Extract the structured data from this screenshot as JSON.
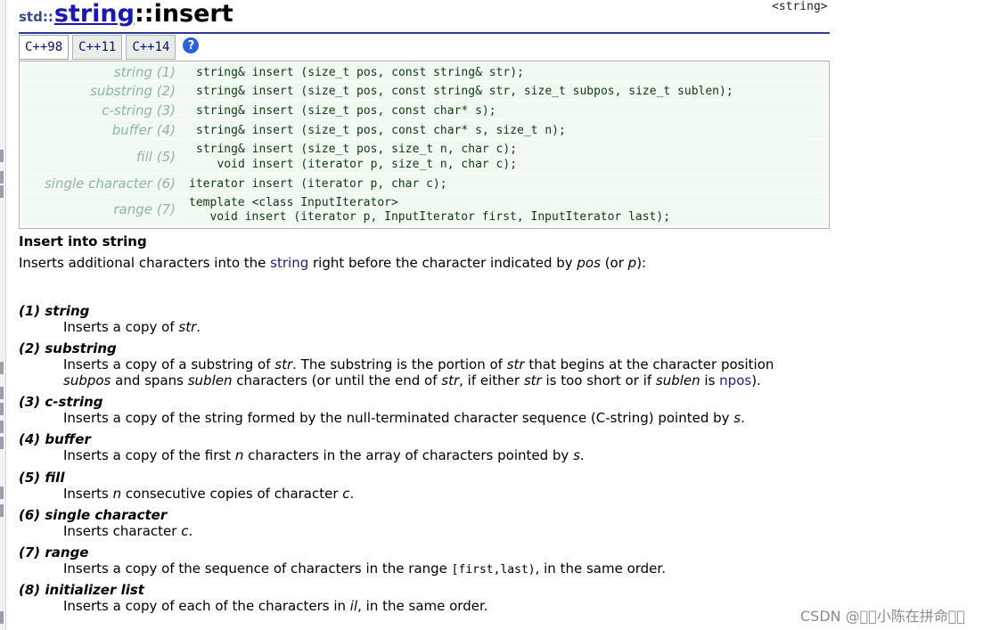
{
  "title": {
    "namespace": "std::",
    "class_name": "string",
    "separator": "::",
    "function": "insert"
  },
  "header_tag": "<string>",
  "tabs": [
    {
      "label": "C++98"
    },
    {
      "label": "C++11"
    },
    {
      "label": "C++14"
    }
  ],
  "help_icon_label": "?",
  "prototypes": [
    {
      "label": "string (1)",
      "lines": [
        "string& insert (size_t pos, const string& str);"
      ]
    },
    {
      "label": "substring (2)",
      "lines": [
        "string& insert (size_t pos, const string& str, size_t subpos, size_t sublen);"
      ]
    },
    {
      "label": "c-string (3)",
      "lines": [
        "string& insert (size_t pos, const char* s);"
      ]
    },
    {
      "label": "buffer (4)",
      "lines": [
        "string& insert (size_t pos, const char* s, size_t n);"
      ]
    },
    {
      "label": "fill (5)",
      "lines": [
        "string& insert (size_t pos, size_t n, char c);",
        "   void insert (iterator p, size_t n, char c);"
      ]
    },
    {
      "label": "single character (6)",
      "lines": [
        "iterator insert (iterator p, char c);"
      ]
    },
    {
      "label": "range (7)",
      "lines": [
        "template <class InputIterator>",
        "   void insert (iterator p, InputIterator first, InputIterator last);"
      ]
    }
  ],
  "heading": "Insert into string",
  "intro": {
    "before": "Inserts additional characters into the ",
    "link": "string",
    "middle": " right before the character indicated by ",
    "pos": "pos",
    "or": " (or ",
    "p": "p",
    "end": "):"
  },
  "sections": [
    {
      "head": "(1) string",
      "desc": [
        [
          {
            "t": "Inserts a copy of "
          },
          {
            "t": "str",
            "i": true
          },
          {
            "t": "."
          }
        ]
      ]
    },
    {
      "head": "(2) substring",
      "desc": [
        [
          {
            "t": "Inserts a copy of a substring of "
          },
          {
            "t": "str",
            "i": true
          },
          {
            "t": ". The substring is the portion of "
          },
          {
            "t": "str",
            "i": true
          },
          {
            "t": " that begins at the character position"
          }
        ],
        [
          {
            "t": "subpos",
            "i": true
          },
          {
            "t": " and spans "
          },
          {
            "t": "sublen",
            "i": true
          },
          {
            "t": " characters (or until the end of "
          },
          {
            "t": "str",
            "i": true
          },
          {
            "t": ", if either "
          },
          {
            "t": "str",
            "i": true
          },
          {
            "t": " is too short or if "
          },
          {
            "t": "sublen",
            "i": true
          },
          {
            "t": " is "
          },
          {
            "t": "npos",
            "l": true
          },
          {
            "t": ")."
          }
        ]
      ]
    },
    {
      "head": "(3) c-string",
      "desc": [
        [
          {
            "t": "Inserts a copy of the string formed by the null-terminated character sequence (C-string) pointed by "
          },
          {
            "t": "s",
            "i": true
          },
          {
            "t": "."
          }
        ]
      ]
    },
    {
      "head": "(4) buffer",
      "desc": [
        [
          {
            "t": "Inserts a copy of the first "
          },
          {
            "t": "n",
            "i": true
          },
          {
            "t": " characters in the array of characters pointed by "
          },
          {
            "t": "s",
            "i": true
          },
          {
            "t": "."
          }
        ]
      ]
    },
    {
      "head": "(5) fill",
      "desc": [
        [
          {
            "t": "Inserts "
          },
          {
            "t": "n",
            "i": true
          },
          {
            "t": " consecutive copies of character "
          },
          {
            "t": "c",
            "i": true
          },
          {
            "t": "."
          }
        ]
      ]
    },
    {
      "head": "(6) single character",
      "desc": [
        [
          {
            "t": "Inserts character "
          },
          {
            "t": "c",
            "i": true
          },
          {
            "t": "."
          }
        ]
      ]
    },
    {
      "head": "(7) range",
      "desc": [
        [
          {
            "t": "Inserts a copy of the sequence of characters in the range "
          },
          {
            "t": "[first,last)",
            "m": true
          },
          {
            "t": ", in the same order."
          }
        ]
      ]
    },
    {
      "head": "(8) initializer list",
      "desc": [
        [
          {
            "t": "Inserts a copy of each of the characters in "
          },
          {
            "t": "il",
            "i": true
          },
          {
            "t": ", in the same order."
          }
        ]
      ]
    }
  ],
  "watermark": "CSDN @\u0000\u0000小陈在拼命\u0000\u0000"
}
